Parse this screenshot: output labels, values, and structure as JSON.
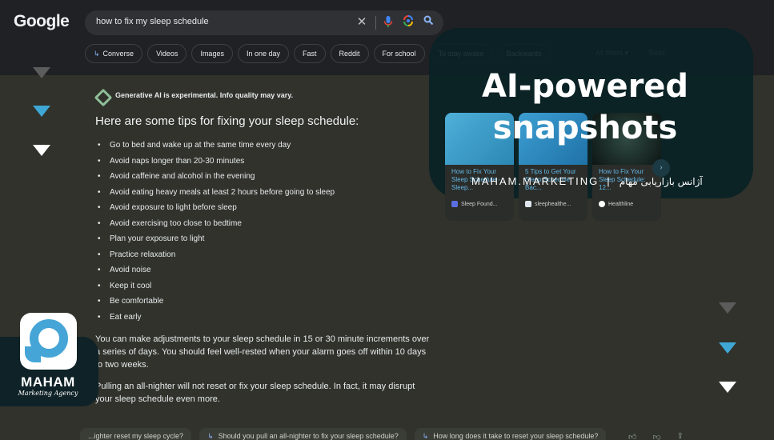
{
  "header": {
    "logo": "Google",
    "search": {
      "value": "how to fix my sleep schedule",
      "icons": [
        "close-icon",
        "mic-icon",
        "lens-icon",
        "search-icon"
      ]
    },
    "chips": [
      {
        "label": "Converse",
        "icon": "arrow-icon"
      },
      {
        "label": "Videos"
      },
      {
        "label": "Images"
      },
      {
        "label": "In one day"
      },
      {
        "label": "Fast"
      },
      {
        "label": "Reddit"
      },
      {
        "label": "For school"
      },
      {
        "label": "To stay awake"
      },
      {
        "label": "Backwards"
      }
    ],
    "all_filters": "All filters ▾",
    "tools": "Tools"
  },
  "ai_answer": {
    "notice": "Generative AI is experimental. Info quality may vary.",
    "heading": "Here are some tips for fixing your sleep schedule:",
    "tips": [
      "Go to bed and wake up at the same time every day",
      "Avoid naps longer than 20-30 minutes",
      "Avoid caffeine and alcohol in the evening",
      "Avoid eating heavy meals at least 2 hours before going to sleep",
      "Avoid exposure to light before sleep",
      "Avoid exercising too close to bedtime",
      "Plan your exposure to light",
      "Practice relaxation",
      "Avoid noise",
      "Keep it cool",
      "Be comfortable",
      "Eat early"
    ],
    "paragraph1": "You can make adjustments to your sleep schedule in 15 or 30 minute increments over a series of days. You should feel well-rested when your alarm goes off within 10 days to two weeks.",
    "paragraph2": "Pulling an all-nighter will not reset or fix your sleep schedule. In fact, it may disrupt your sleep schedule even more."
  },
  "source_cards": [
    {
      "title": "How to Fix Your Sleep Schedule - Sleep...",
      "source": "Sleep Found..."
    },
    {
      "title": "5 Tips to Get Your Sleep Schedule Bac...",
      "source": "sleephealthe..."
    },
    {
      "title": "How to Fix Your Sleep Schedule: 12...",
      "source": "Healthline"
    }
  ],
  "followups": [
    "...ighter reset my sleep cycle?",
    "Should you pull an all-nighter to fix your sleep schedule?",
    "How long does it take to reset your sleep schedule?"
  ],
  "feedback_icons": [
    "thumbs-up-icon",
    "thumbs-down-icon",
    "share-icon"
  ],
  "overlay": {
    "title_line1": "AI-powered",
    "title_line2": "snapshots",
    "brand_en": "MAHAM.MARKETING",
    "separator": "|",
    "brand_fa": "آژانس بازاریابی مهام"
  },
  "logo_block": {
    "word": "MAHAM",
    "sub": "Marketing Agency"
  },
  "colors": {
    "accent_blue": "#3fa7d6",
    "background": "#30322b",
    "topbar": "#202124",
    "overlay_panel": "#092126"
  }
}
